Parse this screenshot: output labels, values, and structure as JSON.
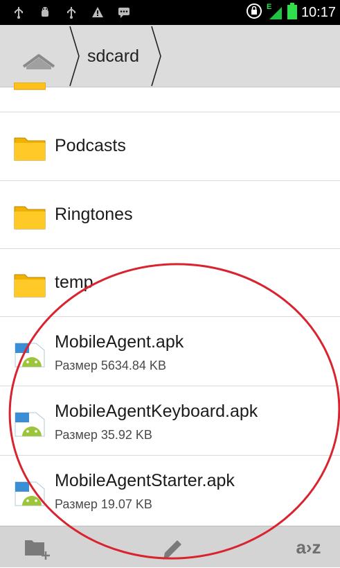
{
  "status_bar": {
    "time": "10:17",
    "network": "E",
    "left_icons": [
      "usb-icon",
      "android-debug-icon",
      "usb-icon",
      "warning-icon",
      "message-icon"
    ],
    "right_icons": [
      "rotation-lock-icon",
      "signal-icon",
      "battery-icon"
    ]
  },
  "breadcrumb": {
    "home_icon": "home-icon",
    "items": [
      {
        "label": "sdcard"
      }
    ]
  },
  "file_list": {
    "items": [
      {
        "name": "Podcasts",
        "type": "folder"
      },
      {
        "name": "Ringtones",
        "type": "folder"
      },
      {
        "name": "temp",
        "type": "folder"
      },
      {
        "name": "MobileAgent.apk",
        "type": "apk",
        "size": "Размер 5634.84 KB"
      },
      {
        "name": "MobileAgentKeyboard.apk",
        "type": "apk",
        "size": "Размер 35.92 KB"
      },
      {
        "name": "MobileAgentStarter.apk",
        "type": "apk",
        "size": "Размер 19.07 KB"
      }
    ]
  },
  "bottom_bar": {
    "new_folder_icon": "new-folder-icon",
    "edit_icon": "pencil-icon",
    "sort_label": "a›z"
  },
  "colors": {
    "status_bar_bg": "#000000",
    "crumb_bar_bg": "#dcdcdc",
    "folder_yellow": "#ffc21a",
    "apk_green": "#9dc53b",
    "annotation_red": "#d9232f",
    "bottom_bar_bg": "#d4d4d4"
  }
}
